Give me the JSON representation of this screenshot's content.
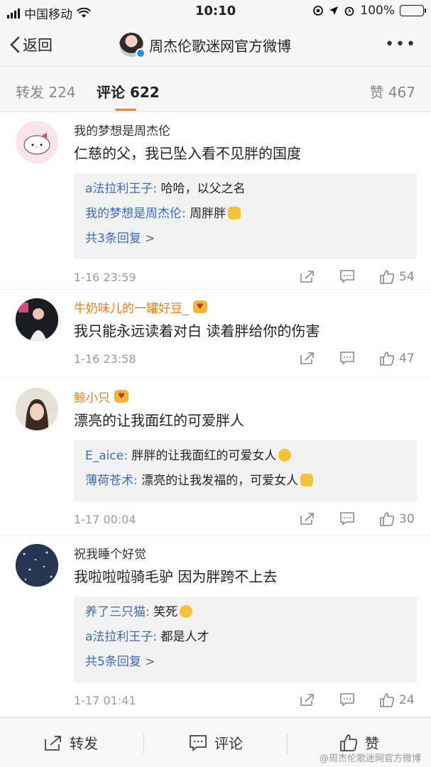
{
  "status_bar": {
    "carrier": "中国移动",
    "time": "10:10",
    "battery": "100%"
  },
  "nav": {
    "back_label": "返回",
    "title": "周杰伦歌迷网官方微博",
    "more_label": "•••"
  },
  "tabs": {
    "repost": "转发 224",
    "comments": "评论 622",
    "likes": "赞 467"
  },
  "comments": [
    {
      "name": "我的梦想是周杰伦",
      "text": "仁慈的父，我已坠入看不见胖的国度",
      "replies": [
        {
          "name": "a法拉利王子:",
          "text": " 哈哈，以父之名"
        },
        {
          "name": "我的梦想是周杰伦:",
          "text": " 周胖胖"
        }
      ],
      "more": "共3条回复 >",
      "time": "1-16 23:59",
      "likes": "54"
    },
    {
      "name": "牛奶味儿的一罐好豆_",
      "text": "我只能永远读着对白 读着胖给你的伤害",
      "time": "1-16 23:58",
      "likes": "47"
    },
    {
      "name": "鲸小只",
      "text": "漂亮的让我面红的可爱胖人",
      "replies": [
        {
          "name": "E_aice:",
          "text": " 胖胖的让我面红的可爱女人"
        },
        {
          "name": "薄荷苍术:",
          "text": " 漂亮的让我发福的，可爱女人"
        }
      ],
      "time": "1-17 00:04",
      "likes": "30"
    },
    {
      "name": "祝我睡个好觉",
      "text": "我啦啦啦骑毛驴 因为胖跨不上去",
      "replies": [
        {
          "name": "养了三只猫:",
          "text": " 笑死"
        },
        {
          "name": "a法拉利王子:",
          "text": " 都是人才"
        }
      ],
      "more": "共5条回复 >",
      "time": "1-17 01:41",
      "likes": "24"
    }
  ],
  "toolbar": {
    "repost": "转发",
    "comment": "评论",
    "like": "赞"
  },
  "watermark": "@周杰伦歌迷网官方微博"
}
